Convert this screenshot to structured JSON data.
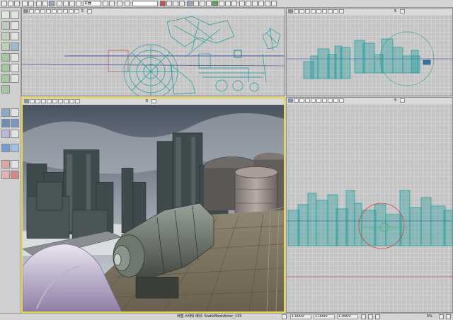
{
  "toolbar": {
    "combo_value": "玄器",
    "search_value": "",
    "icons": [
      "new-icon",
      "open-icon",
      "save-icon",
      "undo-icon",
      "redo-icon",
      "cut-icon",
      "copy-icon",
      "paste-icon",
      "browser-icon",
      "actor-icon",
      "build-icon",
      "play-icon",
      "stop-icon",
      "lighting-icon",
      "paths-icon",
      "geometry-icon"
    ]
  },
  "viewports": {
    "top_left": {
      "name": "top-viewport",
      "zoom_label": "5"
    },
    "top_right": {
      "name": "side-viewport",
      "zoom_label": "5"
    },
    "perspective": {
      "name": "perspective-viewport",
      "zoom_label": "5"
    },
    "bottom_right": {
      "name": "front-viewport",
      "zoom_label": "5"
    }
  },
  "status": {
    "selection_text": "레벨 스태틱 메쉬: StaticMeshActor_133",
    "coord_x": "1.0000",
    "coord_y": "1.0000",
    "coord_z": "1.0000",
    "zoom_percent": "5%"
  },
  "colors": {
    "wire": "#1a9a9a",
    "selection": "#d83a3a",
    "active_border": "#e8d84a",
    "grid": "#c4c4c4"
  }
}
